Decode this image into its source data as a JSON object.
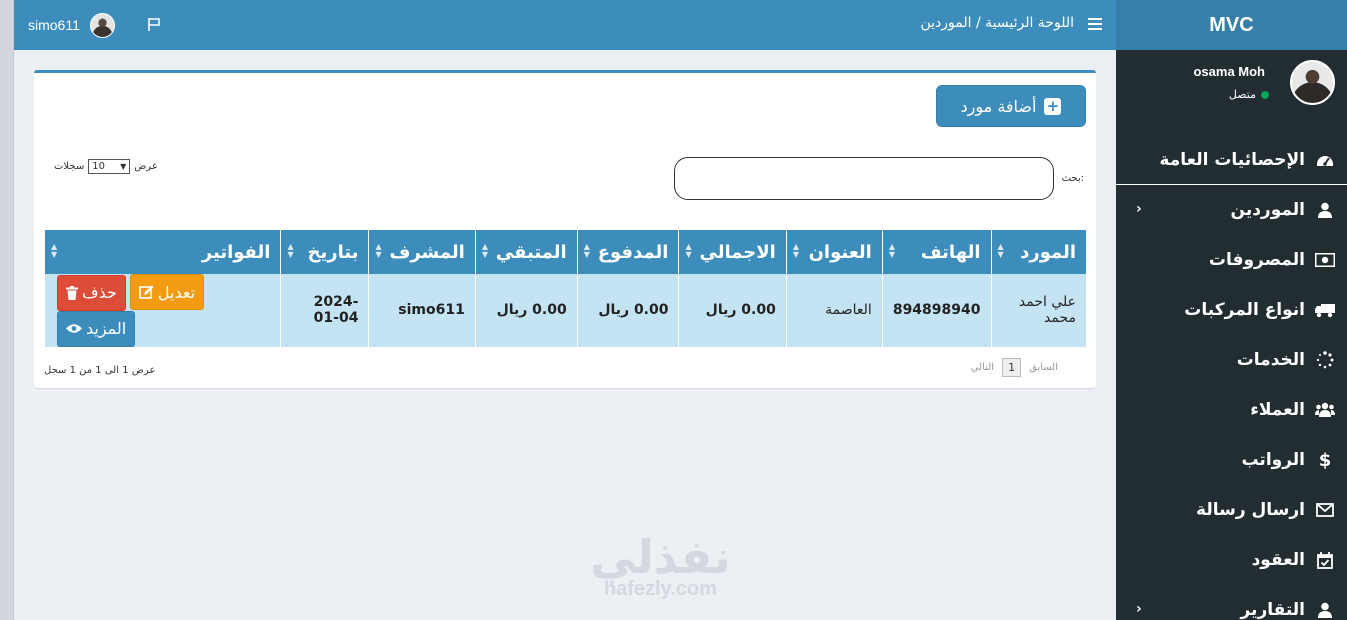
{
  "navbar": {
    "username": "simo611",
    "breadcrumb": "اللوحة الرئيسية / الموردين"
  },
  "logo": "MVC",
  "sidebar": {
    "user_name": "osama Moh",
    "status": "متصل",
    "items": [
      {
        "label": "الإحصائيات العامة",
        "icon": "dashboard-icon"
      },
      {
        "label": "الموردين",
        "icon": "user-icon",
        "has_children": true
      },
      {
        "label": "المصروفات",
        "icon": "money-icon"
      },
      {
        "label": "انواع المركبات",
        "icon": "truck-icon"
      },
      {
        "label": "الخدمات",
        "icon": "spinner-icon"
      },
      {
        "label": "العملاء",
        "icon": "users-icon"
      },
      {
        "label": "الرواتب",
        "icon": "dollar-icon"
      },
      {
        "label": "ارسال رسالة",
        "icon": "envelope-icon"
      },
      {
        "label": "العقود",
        "icon": "calendar-check-icon"
      },
      {
        "label": "التقارير",
        "icon": "user-icon",
        "has_children": true
      }
    ]
  },
  "content": {
    "add_button": "أضافة مورد",
    "search_label": "بحث:",
    "length": {
      "prefix": "عرض",
      "value": "10",
      "suffix": "سجلات"
    },
    "columns": [
      "المورد",
      "الهاتف",
      "العنوان",
      "الاجمالي",
      "المدفوع",
      "المتبقي",
      "المشرف",
      "بتاريخ",
      "الفواتير"
    ],
    "rows": [
      {
        "supplier": "علي احمد محمد",
        "phone": "894898940",
        "address": "العاصمة",
        "total": "0.00 ريال",
        "paid": "0.00 ريال",
        "remaining": "0.00 ريال",
        "supervisor": "simo611",
        "date": "2024-01-04",
        "actions": {
          "more": "المزيد",
          "edit": "تعديل",
          "delete": "حذف"
        }
      }
    ],
    "info": "عرض 1 الى 1 من 1 سجل",
    "pager": {
      "prev": "السابق",
      "page": "1",
      "next": "التالي"
    }
  },
  "watermark": {
    "arabic": "نفذلي",
    "latin": "nafezly.com"
  },
  "colors": {
    "primary": "#3c8dbc",
    "sidebar": "#222d32",
    "edit": "#f39c12",
    "delete": "#dd4b39",
    "row": "#c4e3f3"
  }
}
